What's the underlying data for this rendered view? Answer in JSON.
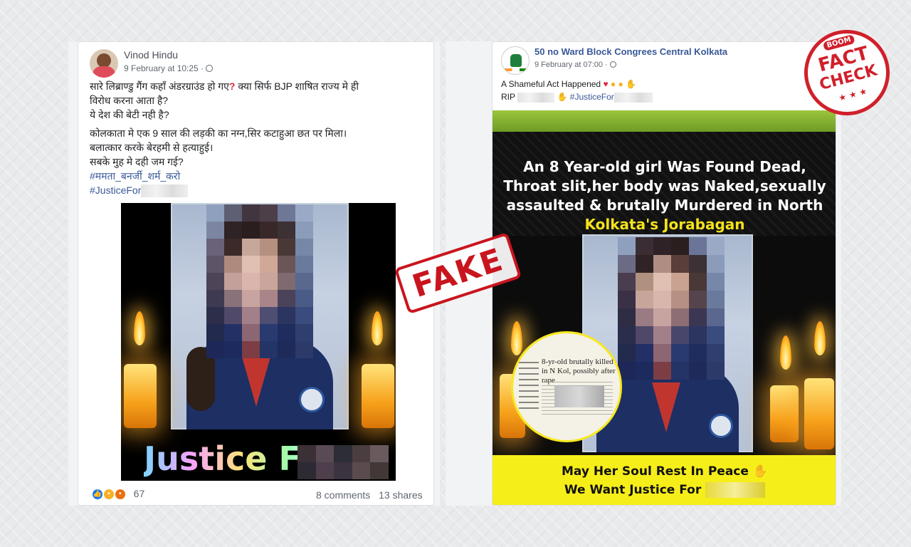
{
  "left_post": {
    "author": "Vinod Hindu",
    "timestamp": "9 February at 10:25 ·",
    "line1": "सारे लिब्राण्डु गैंग कहाँ अंडरग्राउंड हो गए",
    "line1_after": " क्या सिर्फ BJP शाषित राज्य मे ही",
    "line2": "विरोध करना आता है?",
    "line3": "ये देश की बेटी नही है?",
    "line4": "कोलकाता मे एक 9 साल की लड़की का नग्न,सिर कटाहुआ छत पर मिला।",
    "line5": "बलात्कार करके बेरहमी से हत्याहुई।",
    "line6": "सबके मुह मे दही जम गई?",
    "hashtag1": "#ममता_बनर्जी_शर्म_करो",
    "hashtag2": "#JusticeFor",
    "image_caption": "Justice For",
    "reaction_count": "67",
    "comments": "8 comments",
    "shares": "13 shares"
  },
  "right_post": {
    "author": "50 no Ward Block Congrees Central Kolkata",
    "timestamp": "9 February at 07:00 ·",
    "line1": "A Shameful Act Happened",
    "line2_prefix": "RIP",
    "line2_hashtag": "#JusticeFor",
    "headline_l1": "An 8 Year-old girl Was Found Dead,",
    "headline_l2": "Throat slit,her body was Naked,sexually",
    "headline_l3": "assaulted & brutally Murdered in North",
    "headline_l4": "Kolkata's Jorabagan",
    "clip_text": "8-yr-old brutally killed in N Kol, possibly after rape",
    "footer_l1": "May Her Soul Rest In Peace",
    "footer_l2": "We Want Justice For"
  },
  "stamp": {
    "fake": "FAKE"
  },
  "badge": {
    "brand": "BOOM",
    "line1": "FACT",
    "line2": "CHECK",
    "stars": "★ ★ ★"
  },
  "colors": {
    "accent_red": "#c9151e",
    "facebook_link": "#385898",
    "poster_yellow": "#f6ee19",
    "poster_green": "#9bc53d"
  }
}
